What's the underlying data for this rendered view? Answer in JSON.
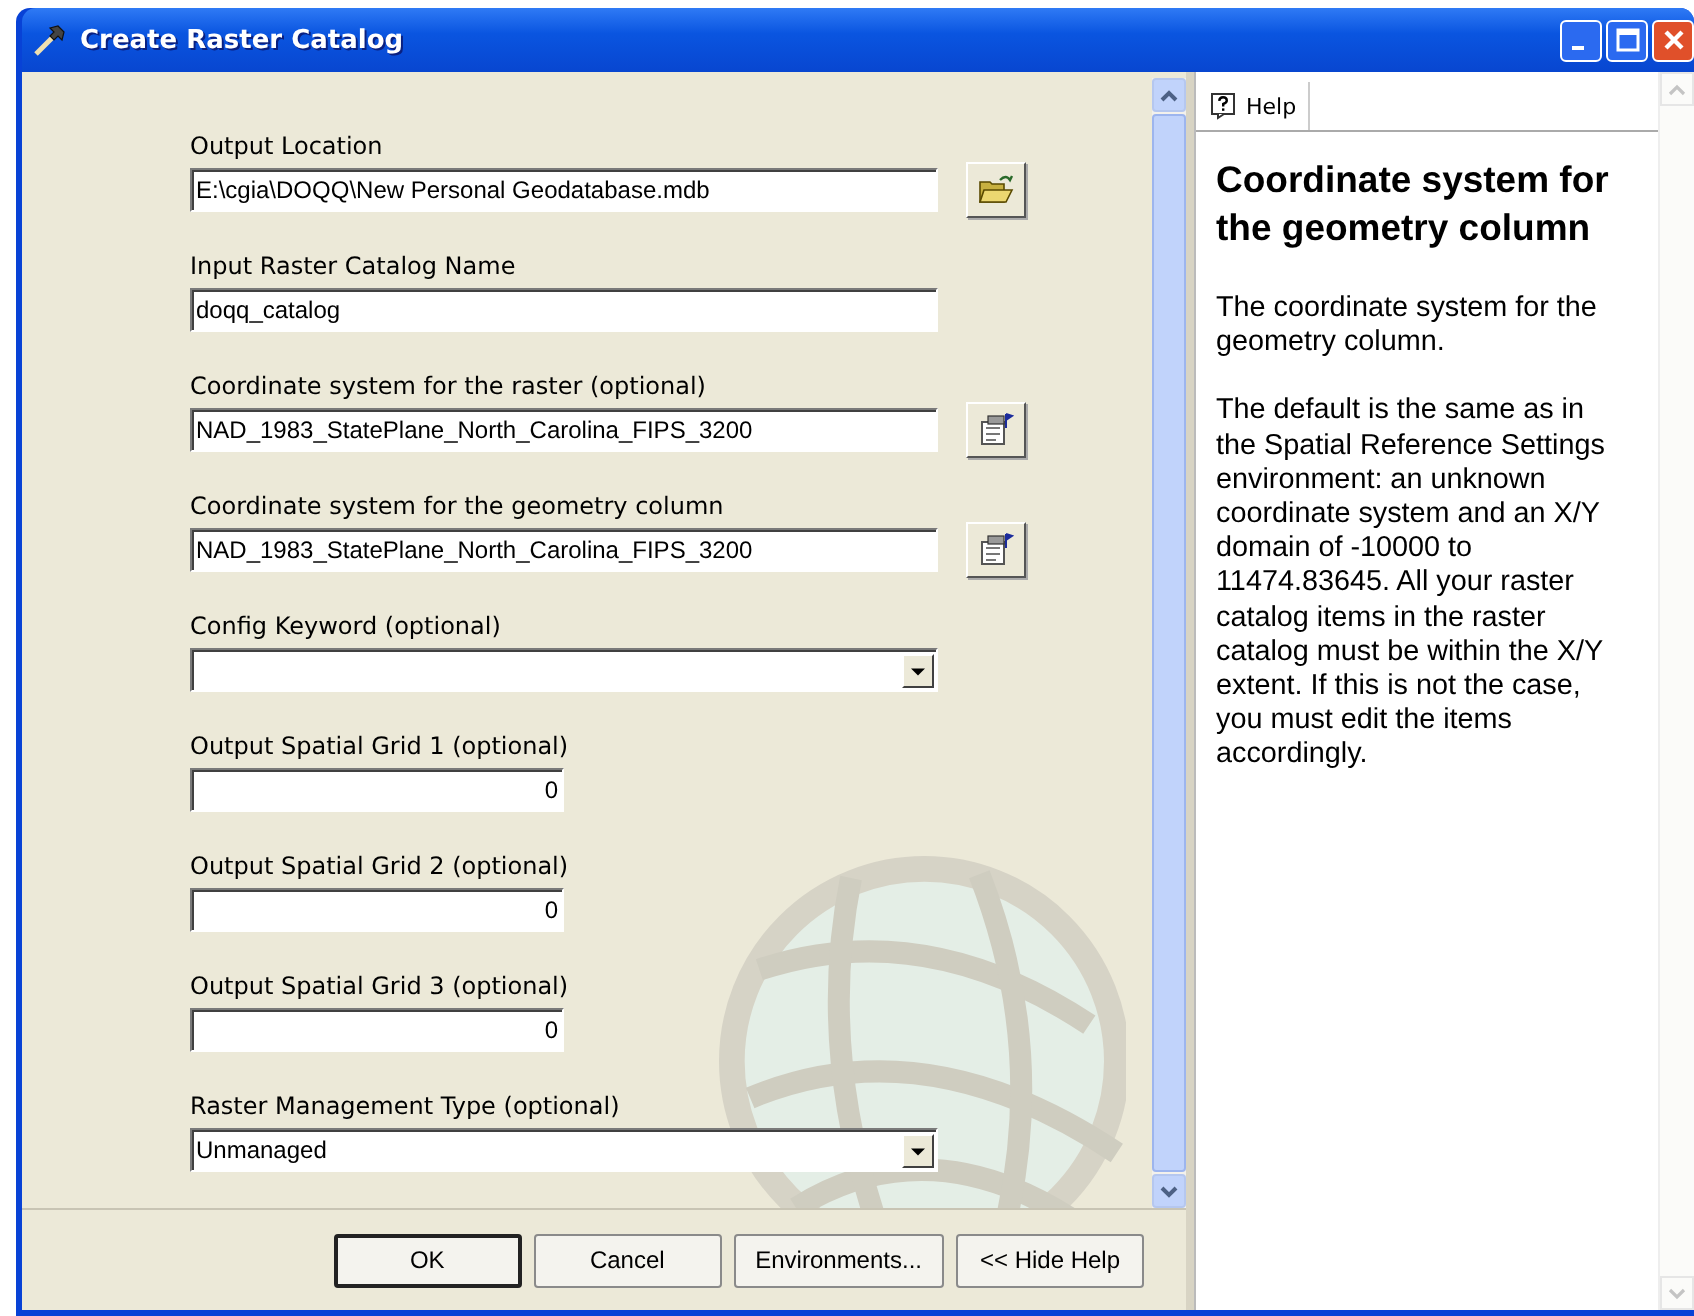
{
  "window": {
    "title": "Create Raster Catalog"
  },
  "fields": [
    {
      "kind": "browse",
      "label": "Output Location",
      "value": "E:\\cgia\\DOQQ\\New Personal Geodatabase.mdb"
    },
    {
      "kind": "text",
      "label": "Input Raster Catalog Name",
      "value": "doqq_catalog"
    },
    {
      "kind": "coordsys",
      "label": "Coordinate system for the raster (optional)",
      "value": "NAD_1983_StatePlane_North_Carolina_FIPS_3200"
    },
    {
      "kind": "coordsys",
      "label": "Coordinate system for the geometry column",
      "value": "NAD_1983_StatePlane_North_Carolina_FIPS_3200"
    },
    {
      "kind": "dropdown",
      "label": "Config Keyword (optional)"
    },
    {
      "kind": "number",
      "label": "Output Spatial Grid 1 (optional)",
      "value": "0"
    },
    {
      "kind": "number",
      "label": "Output Spatial Grid 2 (optional)",
      "value": "0"
    },
    {
      "kind": "number",
      "label": "Output Spatial Grid 3 (optional)",
      "value": "0"
    },
    {
      "kind": "dropdown",
      "label": "Raster Management Type (optional)",
      "value": "Unmanaged"
    }
  ],
  "buttons": [
    {
      "label": "OK",
      "default": true
    },
    {
      "label": "Cancel",
      "default": false
    },
    {
      "label": "Environments...",
      "default": false
    },
    {
      "label": "<< Hide Help",
      "default": false
    }
  ],
  "help": {
    "tab": "Help",
    "title": "Coordinate system for the geometry column",
    "paragraphs": [
      "The coordinate system for the geometry column.",
      "The default is the same as in the Spatial Reference Settings environment: an unknown coordinate system and an X/Y domain of -10000 to 11474.83645. All your raster catalog items in the raster catalog must be within the X/Y extent. If this is not the case, you must edit the items accordingly."
    ]
  }
}
